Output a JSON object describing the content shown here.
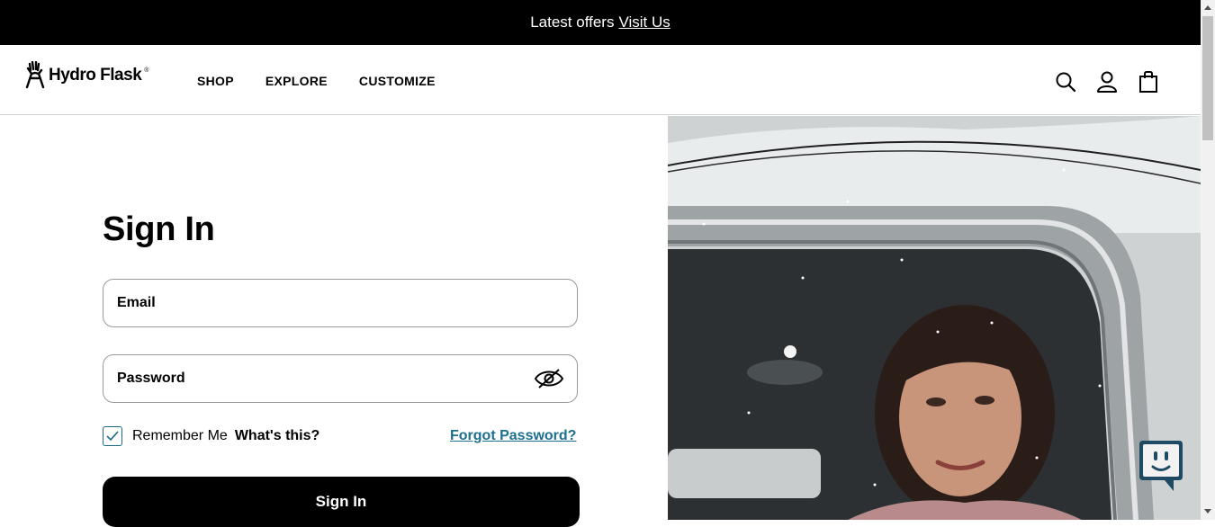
{
  "promo": {
    "text": "Latest offers",
    "link": "Visit Us"
  },
  "header": {
    "logo": "Hydro Flask",
    "nav": [
      "SHOP",
      "EXPLORE",
      "CUSTOMIZE"
    ],
    "icons": [
      "search-icon",
      "account-icon",
      "cart-icon"
    ]
  },
  "signin": {
    "title": "Sign In",
    "email_placeholder": "Email",
    "password_placeholder": "Password",
    "remember_label": "Remember Me",
    "whats_this": "What's this?",
    "forgot": "Forgot Password?",
    "button": "Sign In",
    "remember_checked": true
  },
  "colors": {
    "link": "#1b6f8f",
    "checkbox": "#1a6b8a",
    "button_bg": "#000000",
    "chat_bg": "#1f4a63"
  }
}
